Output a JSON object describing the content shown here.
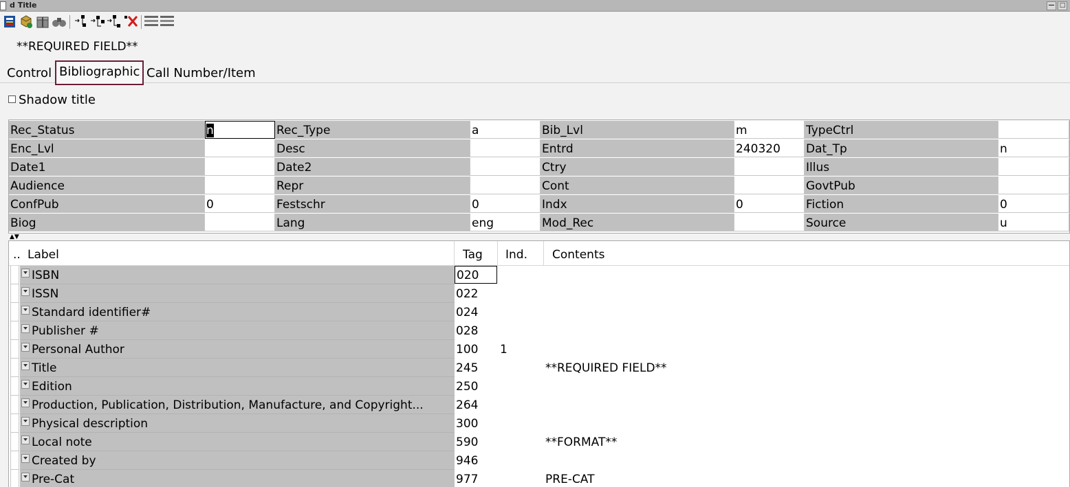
{
  "window": {
    "title": "d Title"
  },
  "toolbar": {
    "icons": [
      "record-view-icon",
      "save-icon",
      "gift-icon",
      "binoculars-icon",
      "insert-field-icon",
      "insert-subfield-icon",
      "delete-field-icon",
      "template-icon"
    ]
  },
  "header": {
    "required_text": "**REQUIRED FIELD**"
  },
  "tabs": [
    {
      "label": "Control"
    },
    {
      "label": "Bibliographic"
    },
    {
      "label": "Call Number/Item"
    }
  ],
  "shadow": {
    "label": "Shadow title"
  },
  "fixed_fields": [
    [
      {
        "label": "Rec_Status",
        "value": "n"
      },
      {
        "label": "Rec_Type",
        "value": "a"
      },
      {
        "label": "Bib_Lvl",
        "value": "m"
      },
      {
        "label": "TypeCtrl",
        "value": ""
      }
    ],
    [
      {
        "label": "Enc_Lvl",
        "value": ""
      },
      {
        "label": "Desc",
        "value": ""
      },
      {
        "label": "Entrd",
        "value": "240320"
      },
      {
        "label": "Dat_Tp",
        "value": "n"
      }
    ],
    [
      {
        "label": "Date1",
        "value": ""
      },
      {
        "label": "Date2",
        "value": ""
      },
      {
        "label": "Ctry",
        "value": ""
      },
      {
        "label": "Illus",
        "value": ""
      }
    ],
    [
      {
        "label": "Audience",
        "value": ""
      },
      {
        "label": "Repr",
        "value": ""
      },
      {
        "label": "Cont",
        "value": ""
      },
      {
        "label": "GovtPub",
        "value": ""
      }
    ],
    [
      {
        "label": "ConfPub",
        "value": "0"
      },
      {
        "label": "Festschr",
        "value": "0"
      },
      {
        "label": "Indx",
        "value": "0"
      },
      {
        "label": "Fiction",
        "value": "0"
      }
    ],
    [
      {
        "label": "Biog",
        "value": ""
      },
      {
        "label": "Lang",
        "value": "eng"
      },
      {
        "label": "Mod_Rec",
        "value": ""
      },
      {
        "label": "Source",
        "value": "u"
      }
    ]
  ],
  "variable_fields": {
    "columns": {
      "gutter": "..",
      "label": "Label",
      "tag": "Tag",
      "ind": "Ind.",
      "contents": "Contents"
    },
    "rows": [
      {
        "label": "ISBN",
        "tag": "020",
        "ind": "",
        "contents": ""
      },
      {
        "label": "ISSN",
        "tag": "022",
        "ind": "",
        "contents": ""
      },
      {
        "label": "Standard identifier#",
        "tag": "024",
        "ind": "",
        "contents": ""
      },
      {
        "label": "Publisher #",
        "tag": "028",
        "ind": "",
        "contents": ""
      },
      {
        "label": "Personal Author",
        "tag": "100",
        "ind": "1",
        "contents": ""
      },
      {
        "label": "Title",
        "tag": "245",
        "ind": "",
        "contents": "**REQUIRED FIELD**"
      },
      {
        "label": "Edition",
        "tag": "250",
        "ind": "",
        "contents": ""
      },
      {
        "label": "Production, Publication, Distribution, Manufacture, and Copyright...",
        "tag": "264",
        "ind": "",
        "contents": ""
      },
      {
        "label": "Physical description",
        "tag": "300",
        "ind": "",
        "contents": ""
      },
      {
        "label": "Local note",
        "tag": "590",
        "ind": "",
        "contents": "**FORMAT**"
      },
      {
        "label": "Created by",
        "tag": "946",
        "ind": "",
        "contents": ""
      },
      {
        "label": "Pre-Cat",
        "tag": "977",
        "ind": "",
        "contents": "PRE-CAT"
      }
    ]
  }
}
